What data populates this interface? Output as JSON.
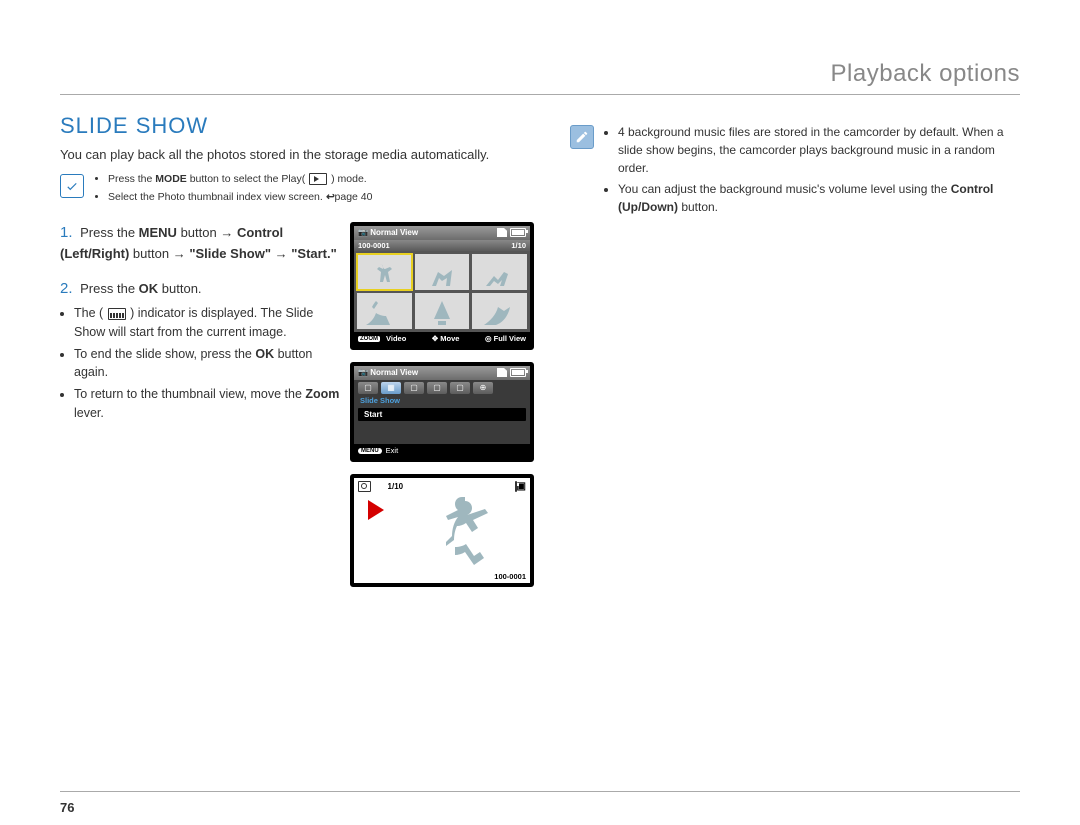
{
  "header": {
    "title": "Playback options"
  },
  "section": {
    "title": "SLIDE SHOW",
    "intro": "You can play back all the photos stored in the storage media automatically."
  },
  "prereq": {
    "line1_prefix": "Press the ",
    "line1_bold": "MODE",
    "line1_mid": " button to select the Play( ",
    "line1_suffix": " ) mode.",
    "line2_prefix": "Select the Photo thumbnail index view screen. ",
    "line2_pageref": "page 40"
  },
  "steps": {
    "s1": {
      "num": "1.",
      "t1": "Press the ",
      "b1": "MENU",
      "t2": " button ",
      "arrow": "→",
      "b2": "Control (Left/Right)",
      "t3": " button ",
      "b3": "\"Slide Show\"",
      "b4": "\"Start.\""
    },
    "s2": {
      "num": "2.",
      "t1": "Press the ",
      "b1": "OK",
      "t2": " button.",
      "bullet1_t1": "The ( ",
      "bullet1_t2": " ) indicator is displayed. The Slide Show will start from the current image.",
      "bullet2_t1": "To end the slide show, press the ",
      "bullet2_b1": "OK",
      "bullet2_t2": " button again.",
      "bullet3_t1": "To return to the thumbnail view, move the ",
      "bullet3_b1": "Zoom",
      "bullet3_t2": " lever."
    }
  },
  "right_notes": {
    "b1": "4 background music files are stored in the camcorder by default. When a slide show begins, the camcorder plays background music in a random order.",
    "b2_t1": "You can adjust the background music's volume level using the ",
    "b2_b1": "Control (Up/Down)",
    "b2_t2": " button."
  },
  "screen1": {
    "title": "Normal View",
    "folder": "100-0001",
    "counter": "1/10",
    "bottom_left_tag": "ZOOM",
    "bottom_left": "Video",
    "bottom_mid": "Move",
    "bottom_right": "Full View"
  },
  "screen2": {
    "title": "Normal View",
    "menu_label": "Slide Show",
    "menu_item": "Start",
    "footer_btn": "MENU",
    "footer_text": "Exit"
  },
  "screen3": {
    "counter": "1/10",
    "footer": "100-0001"
  },
  "page_number": "76"
}
